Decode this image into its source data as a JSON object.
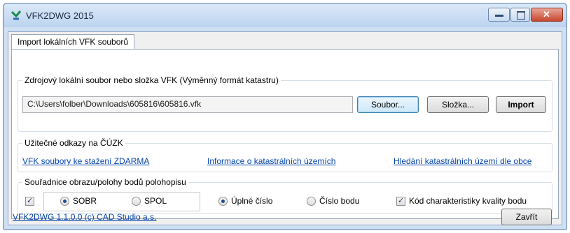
{
  "window": {
    "title": "VFK2DWG 2015",
    "buttons": {
      "minimize_glyph": "—",
      "maximize_glyph": "□",
      "close_glyph": "✕"
    },
    "accent": "#c7462f"
  },
  "tab": {
    "label": "Import lokálních VFK souborů"
  },
  "source_group": {
    "legend": "Zdrojový lokální soubor nebo složka VFK (Výměnný formát katastru)",
    "path_value": "C:\\Users\\folber\\Downloads\\605816\\605816.vfk",
    "file_button": "Soubor...",
    "folder_button": "Složka...",
    "import_button": "Import"
  },
  "links_group": {
    "legend": "Užitečné odkazy na ČÚZK",
    "link1": "VFK soubory ke stažení ZDARMA",
    "link2": "Informace o katastrálních územích",
    "link3": "Hledání katastrálních území dle obce"
  },
  "coords_group": {
    "legend": "Souřadnice obrazu/polohy bodů polohopisu",
    "checkbox_checked": true,
    "radio_sobr": "SOBR",
    "radio_spol": "SPOL",
    "radio_full": "Úplné číslo",
    "radio_point": "Číslo bodu",
    "quality_label": "Kód charakteristiky kvality bodu",
    "quality_checked": true
  },
  "footer": {
    "version_link": "VFK2DWG 1.1.0.0 (c) CAD Studio a.s.",
    "close_button": "Zavřít"
  }
}
